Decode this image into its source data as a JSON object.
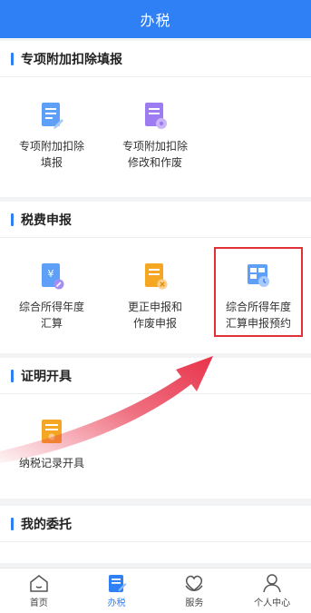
{
  "header": {
    "title": "办税"
  },
  "sections": [
    {
      "title": "专项附加扣除填报",
      "items": [
        {
          "label": "专项附加扣除\n填报",
          "icon": "document-edit-icon"
        },
        {
          "label": "专项附加扣除\n修改和作废",
          "icon": "document-settings-icon"
        }
      ]
    },
    {
      "title": "税费申报",
      "items": [
        {
          "label": "综合所得年度\n汇算",
          "icon": "yen-document-icon"
        },
        {
          "label": "更正申报和\n作废申报",
          "icon": "document-cancel-icon"
        },
        {
          "label": "综合所得年度\n汇算申报预约",
          "icon": "calendar-clock-icon"
        }
      ]
    },
    {
      "title": "证明开具",
      "items": [
        {
          "label": "纳税记录开具",
          "icon": "certificate-icon"
        }
      ]
    },
    {
      "title": "我的委托",
      "items": []
    }
  ],
  "tabbar": {
    "items": [
      {
        "label": "首页",
        "icon": "home-icon",
        "active": false
      },
      {
        "label": "办税",
        "icon": "tax-edit-icon",
        "active": true
      },
      {
        "label": "服务",
        "icon": "service-heart-icon",
        "active": false
      },
      {
        "label": "个人中心",
        "icon": "person-icon",
        "active": false
      }
    ]
  },
  "colors": {
    "primary": "#2f7ff5",
    "highlight": "#e03236",
    "background": "#f2f3f5"
  }
}
